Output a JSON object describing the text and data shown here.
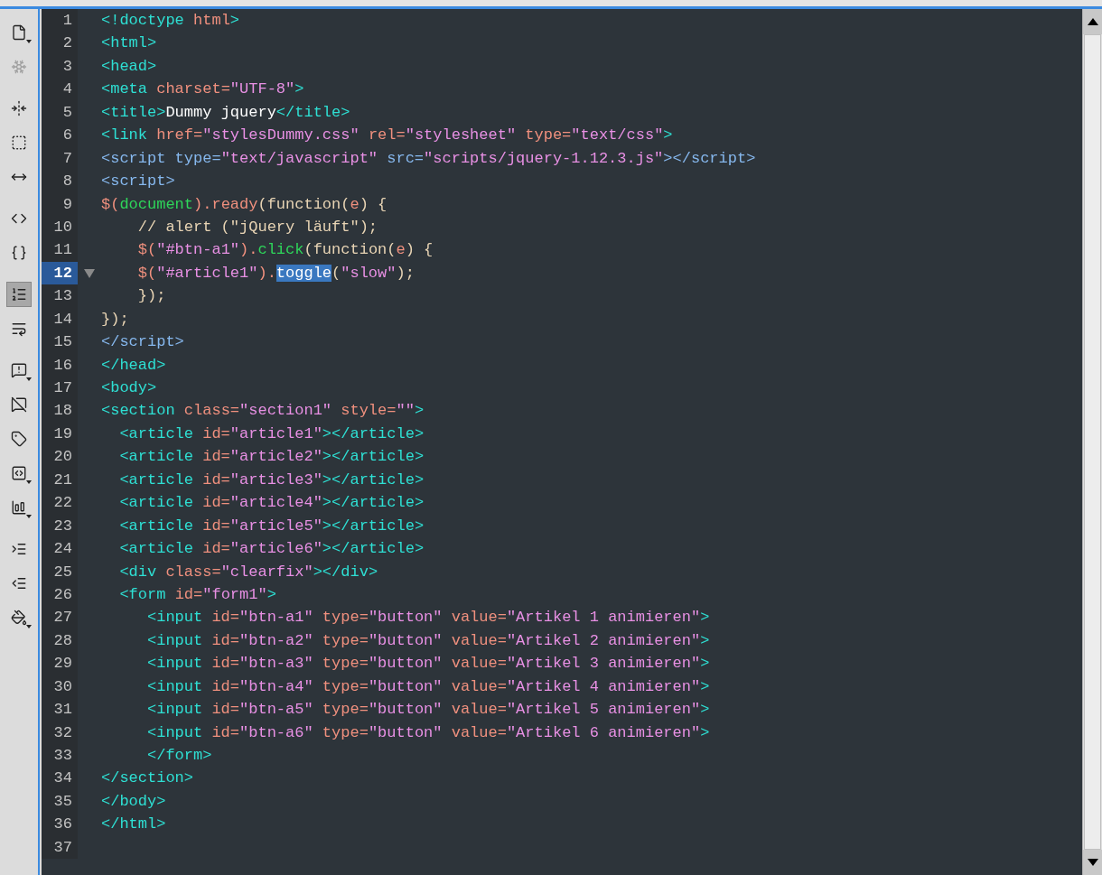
{
  "toolbar": [
    [
      {
        "kind": "page",
        "selected": false,
        "disabled": false,
        "menu": true
      },
      {
        "kind": "web",
        "selected": false,
        "disabled": true,
        "menu": false
      }
    ],
    [
      {
        "kind": "collapse",
        "selected": false,
        "disabled": false,
        "menu": false
      },
      {
        "kind": "collapse-selection",
        "selected": false,
        "disabled": false,
        "menu": false
      },
      {
        "kind": "expand",
        "selected": false,
        "disabled": false,
        "menu": false
      }
    ],
    [
      {
        "kind": "select-parent",
        "selected": false,
        "disabled": false,
        "menu": false
      },
      {
        "kind": "braces",
        "selected": false,
        "disabled": false,
        "menu": false
      }
    ],
    [
      {
        "kind": "line-numbers",
        "selected": true,
        "disabled": false,
        "menu": false
      },
      {
        "kind": "wrap",
        "selected": false,
        "disabled": false,
        "menu": false
      }
    ],
    [
      {
        "kind": "comment",
        "selected": false,
        "disabled": false,
        "menu": true
      },
      {
        "kind": "remove-comment",
        "selected": false,
        "disabled": false,
        "menu": false
      },
      {
        "kind": "tag",
        "selected": false,
        "disabled": false,
        "menu": false
      },
      {
        "kind": "snippet",
        "selected": false,
        "disabled": false,
        "menu": true
      },
      {
        "kind": "blocks",
        "selected": false,
        "disabled": false,
        "menu": true
      }
    ],
    [
      {
        "kind": "indent",
        "selected": false,
        "disabled": false,
        "menu": false
      },
      {
        "kind": "outdent",
        "selected": false,
        "disabled": false,
        "menu": false
      },
      {
        "kind": "format",
        "selected": false,
        "disabled": false,
        "menu": true
      }
    ]
  ],
  "lines": [
    {
      "number": "1",
      "current": false,
      "tokens": [
        {
          "kind": "tag",
          "text": "<!doctype "
        },
        {
          "kind": "attr",
          "text": "html"
        },
        {
          "kind": "tag",
          "text": ">"
        }
      ]
    },
    {
      "number": "2",
      "current": false,
      "tokens": [
        {
          "kind": "tag",
          "text": "<html>"
        }
      ]
    },
    {
      "number": "3",
      "current": false,
      "tokens": [
        {
          "kind": "tag",
          "text": "<head>"
        }
      ]
    },
    {
      "number": "4",
      "current": false,
      "tokens": [
        {
          "kind": "tag",
          "text": "<meta "
        },
        {
          "kind": "attr",
          "text": "charset="
        },
        {
          "kind": "string",
          "text": "\"UTF-8\""
        },
        {
          "kind": "tag",
          "text": ">"
        }
      ]
    },
    {
      "number": "5",
      "current": false,
      "tokens": [
        {
          "kind": "tag",
          "text": "<title>"
        },
        {
          "kind": "text",
          "text": "Dummy jquery"
        },
        {
          "kind": "tag",
          "text": "</title>"
        }
      ]
    },
    {
      "number": "6",
      "current": false,
      "tokens": [
        {
          "kind": "tag",
          "text": "<link "
        },
        {
          "kind": "attr",
          "text": "href="
        },
        {
          "kind": "string",
          "text": "\"stylesDummy.css\" "
        },
        {
          "kind": "attr",
          "text": "rel="
        },
        {
          "kind": "string",
          "text": "\"stylesheet\" "
        },
        {
          "kind": "attr",
          "text": "type="
        },
        {
          "kind": "string",
          "text": "\"text/css\""
        },
        {
          "kind": "tag",
          "text": ">"
        }
      ]
    },
    {
      "number": "7",
      "current": false,
      "tokens": [
        {
          "kind": "script-tag",
          "text": "<script type="
        },
        {
          "kind": "string",
          "text": "\"text/javascript\" "
        },
        {
          "kind": "script-tag",
          "text": "src="
        },
        {
          "kind": "string",
          "text": "\"scripts/jquery-1.12.3.js\""
        },
        {
          "kind": "script-tag",
          "text": "></script>"
        }
      ]
    },
    {
      "number": "8",
      "current": false,
      "tokens": [
        {
          "kind": "script-tag",
          "text": "<script>"
        }
      ]
    },
    {
      "number": "9",
      "current": false,
      "tokens": [
        {
          "kind": "js",
          "text": "$("
        },
        {
          "kind": "object",
          "text": "document"
        },
        {
          "kind": "js",
          "text": ").ready"
        },
        {
          "kind": "plain",
          "text": "(function("
        },
        {
          "kind": "js",
          "text": "e"
        },
        {
          "kind": "plain",
          "text": ") {"
        }
      ]
    },
    {
      "number": "10",
      "current": false,
      "tokens": [
        {
          "kind": "plain",
          "text": "    // alert (\"jQuery läuft\");"
        }
      ]
    },
    {
      "number": "11",
      "current": false,
      "tokens": [
        {
          "kind": "js",
          "text": "    $("
        },
        {
          "kind": "string",
          "text": "\"#btn-a1\""
        },
        {
          "kind": "js",
          "text": ")."
        },
        {
          "kind": "object",
          "text": "click"
        },
        {
          "kind": "plain",
          "text": "(function("
        },
        {
          "kind": "js",
          "text": "e"
        },
        {
          "kind": "plain",
          "text": ") {"
        }
      ]
    },
    {
      "number": "12",
      "current": true,
      "tokens": [
        {
          "kind": "js",
          "text": "    $("
        },
        {
          "kind": "string",
          "text": "\"#article1\""
        },
        {
          "kind": "js",
          "text": ")."
        },
        {
          "kind": "selection",
          "text": "toggle"
        },
        {
          "kind": "plain",
          "text": "("
        },
        {
          "kind": "string",
          "text": "\"slow\""
        },
        {
          "kind": "plain",
          "text": ");"
        }
      ]
    },
    {
      "number": "13",
      "current": false,
      "tokens": [
        {
          "kind": "plain",
          "text": "    });"
        }
      ]
    },
    {
      "number": "14",
      "current": false,
      "tokens": [
        {
          "kind": "plain",
          "text": "});"
        }
      ]
    },
    {
      "number": "15",
      "current": false,
      "tokens": [
        {
          "kind": "script-tag",
          "text": "</script>"
        }
      ]
    },
    {
      "number": "16",
      "current": false,
      "tokens": [
        {
          "kind": "tag",
          "text": "</head>"
        }
      ]
    },
    {
      "number": "17",
      "current": false,
      "tokens": [
        {
          "kind": "tag",
          "text": "<body>"
        }
      ]
    },
    {
      "number": "18",
      "current": false,
      "tokens": [
        {
          "kind": "tag",
          "text": "<section "
        },
        {
          "kind": "attr",
          "text": "class="
        },
        {
          "kind": "string",
          "text": "\"section1\" "
        },
        {
          "kind": "attr",
          "text": "style="
        },
        {
          "kind": "string",
          "text": "\"\""
        },
        {
          "kind": "tag",
          "text": ">"
        }
      ]
    },
    {
      "number": "19",
      "current": false,
      "tokens": [
        {
          "kind": "tag",
          "text": "  <article "
        },
        {
          "kind": "attr",
          "text": "id="
        },
        {
          "kind": "string",
          "text": "\"article1\""
        },
        {
          "kind": "tag",
          "text": "></article>"
        }
      ]
    },
    {
      "number": "20",
      "current": false,
      "tokens": [
        {
          "kind": "tag",
          "text": "  <article "
        },
        {
          "kind": "attr",
          "text": "id="
        },
        {
          "kind": "string",
          "text": "\"article2\""
        },
        {
          "kind": "tag",
          "text": "></article>"
        }
      ]
    },
    {
      "number": "21",
      "current": false,
      "tokens": [
        {
          "kind": "tag",
          "text": "  <article "
        },
        {
          "kind": "attr",
          "text": "id="
        },
        {
          "kind": "string",
          "text": "\"article3\""
        },
        {
          "kind": "tag",
          "text": "></article>"
        }
      ]
    },
    {
      "number": "22",
      "current": false,
      "tokens": [
        {
          "kind": "tag",
          "text": "  <article "
        },
        {
          "kind": "attr",
          "text": "id="
        },
        {
          "kind": "string",
          "text": "\"article4\""
        },
        {
          "kind": "tag",
          "text": "></article>"
        }
      ]
    },
    {
      "number": "23",
      "current": false,
      "tokens": [
        {
          "kind": "tag",
          "text": "  <article "
        },
        {
          "kind": "attr",
          "text": "id="
        },
        {
          "kind": "string",
          "text": "\"article5\""
        },
        {
          "kind": "tag",
          "text": "></article>"
        }
      ]
    },
    {
      "number": "24",
      "current": false,
      "tokens": [
        {
          "kind": "tag",
          "text": "  <article "
        },
        {
          "kind": "attr",
          "text": "id="
        },
        {
          "kind": "string",
          "text": "\"article6\""
        },
        {
          "kind": "tag",
          "text": "></article>"
        }
      ]
    },
    {
      "number": "25",
      "current": false,
      "tokens": [
        {
          "kind": "tag",
          "text": "  <div "
        },
        {
          "kind": "attr",
          "text": "class="
        },
        {
          "kind": "string",
          "text": "\"clearfix\""
        },
        {
          "kind": "tag",
          "text": "></div>"
        }
      ]
    },
    {
      "number": "26",
      "current": false,
      "tokens": [
        {
          "kind": "tag",
          "text": "  <form "
        },
        {
          "kind": "attr",
          "text": "id="
        },
        {
          "kind": "string",
          "text": "\"form1\""
        },
        {
          "kind": "tag",
          "text": ">"
        }
      ]
    },
    {
      "number": "27",
      "current": false,
      "tokens": [
        {
          "kind": "tag",
          "text": "     <input "
        },
        {
          "kind": "attr",
          "text": "id="
        },
        {
          "kind": "string",
          "text": "\"btn-a1\" "
        },
        {
          "kind": "attr",
          "text": "type="
        },
        {
          "kind": "string",
          "text": "\"button\" "
        },
        {
          "kind": "attr",
          "text": "value="
        },
        {
          "kind": "string",
          "text": "\"Artikel 1 animieren\""
        },
        {
          "kind": "tag",
          "text": ">"
        }
      ]
    },
    {
      "number": "28",
      "current": false,
      "tokens": [
        {
          "kind": "tag",
          "text": "     <input "
        },
        {
          "kind": "attr",
          "text": "id="
        },
        {
          "kind": "string",
          "text": "\"btn-a2\" "
        },
        {
          "kind": "attr",
          "text": "type="
        },
        {
          "kind": "string",
          "text": "\"button\" "
        },
        {
          "kind": "attr",
          "text": "value="
        },
        {
          "kind": "string",
          "text": "\"Artikel 2 animieren\""
        },
        {
          "kind": "tag",
          "text": ">"
        }
      ]
    },
    {
      "number": "29",
      "current": false,
      "tokens": [
        {
          "kind": "tag",
          "text": "     <input "
        },
        {
          "kind": "attr",
          "text": "id="
        },
        {
          "kind": "string",
          "text": "\"btn-a3\" "
        },
        {
          "kind": "attr",
          "text": "type="
        },
        {
          "kind": "string",
          "text": "\"button\" "
        },
        {
          "kind": "attr",
          "text": "value="
        },
        {
          "kind": "string",
          "text": "\"Artikel 3 animieren\""
        },
        {
          "kind": "tag",
          "text": ">"
        }
      ]
    },
    {
      "number": "30",
      "current": false,
      "tokens": [
        {
          "kind": "tag",
          "text": "     <input "
        },
        {
          "kind": "attr",
          "text": "id="
        },
        {
          "kind": "string",
          "text": "\"btn-a4\" "
        },
        {
          "kind": "attr",
          "text": "type="
        },
        {
          "kind": "string",
          "text": "\"button\" "
        },
        {
          "kind": "attr",
          "text": "value="
        },
        {
          "kind": "string",
          "text": "\"Artikel 4 animieren\""
        },
        {
          "kind": "tag",
          "text": ">"
        }
      ]
    },
    {
      "number": "31",
      "current": false,
      "tokens": [
        {
          "kind": "tag",
          "text": "     <input "
        },
        {
          "kind": "attr",
          "text": "id="
        },
        {
          "kind": "string",
          "text": "\"btn-a5\" "
        },
        {
          "kind": "attr",
          "text": "type="
        },
        {
          "kind": "string",
          "text": "\"button\" "
        },
        {
          "kind": "attr",
          "text": "value="
        },
        {
          "kind": "string",
          "text": "\"Artikel 5 animieren\""
        },
        {
          "kind": "tag",
          "text": ">"
        }
      ]
    },
    {
      "number": "32",
      "current": false,
      "tokens": [
        {
          "kind": "tag",
          "text": "     <input "
        },
        {
          "kind": "attr",
          "text": "id="
        },
        {
          "kind": "string",
          "text": "\"btn-a6\" "
        },
        {
          "kind": "attr",
          "text": "type="
        },
        {
          "kind": "string",
          "text": "\"button\" "
        },
        {
          "kind": "attr",
          "text": "value="
        },
        {
          "kind": "string",
          "text": "\"Artikel 6 animieren\""
        },
        {
          "kind": "tag",
          "text": ">"
        }
      ]
    },
    {
      "number": "33",
      "current": false,
      "tokens": [
        {
          "kind": "tag",
          "text": "     </form>"
        }
      ]
    },
    {
      "number": "34",
      "current": false,
      "tokens": [
        {
          "kind": "tag",
          "text": "</section>"
        }
      ]
    },
    {
      "number": "35",
      "current": false,
      "tokens": [
        {
          "kind": "tag",
          "text": "</body>"
        }
      ]
    },
    {
      "number": "36",
      "current": false,
      "tokens": [
        {
          "kind": "tag",
          "text": "</html>"
        }
      ]
    },
    {
      "number": "37",
      "current": false
    }
  ]
}
